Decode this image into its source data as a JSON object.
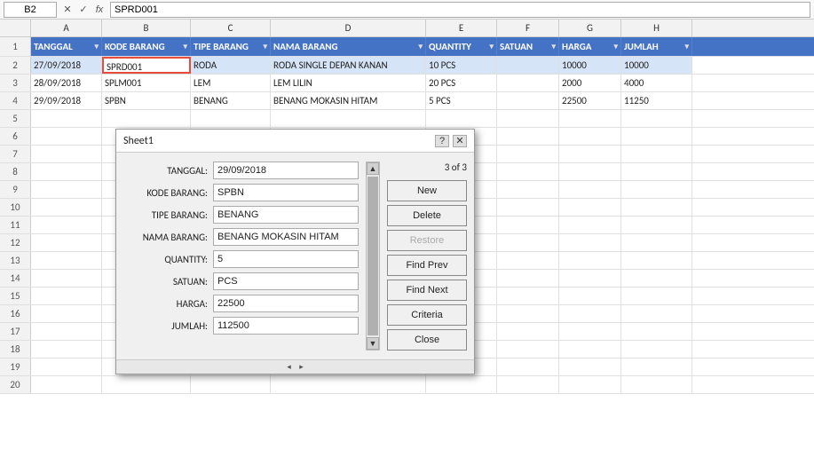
{
  "formulaBar": {
    "nameBox": "B2",
    "formulaValue": "SPRD001",
    "cancelIcon": "✕",
    "confirmIcon": "✓",
    "fxIcon": "fx"
  },
  "colHeaders": [
    "A",
    "B",
    "C",
    "D",
    "E",
    "F",
    "G",
    "H"
  ],
  "tableHeaders": [
    {
      "label": "TANGGAL",
      "col": "col-A"
    },
    {
      "label": "KODE BARANG",
      "col": "col-B"
    },
    {
      "label": "TIPE BARANG",
      "col": "col-C"
    },
    {
      "label": "NAMA BARANG",
      "col": "col-D"
    },
    {
      "label": "QUANTITY",
      "col": "col-E"
    },
    {
      "label": "SATUAN",
      "col": "col-F"
    },
    {
      "label": "HARGA",
      "col": "col-G"
    },
    {
      "label": "JUMLAH",
      "col": "col-H"
    }
  ],
  "rows": [
    {
      "rowNum": "2",
      "tanggal": "27/09/2018",
      "kodeBarang": "SPRD001",
      "tipeBarang": "RODA",
      "namaBarang": "RODA SINGLE DEPAN KANAN",
      "quantity": "10 PCS",
      "satuan": "",
      "harga": "10000",
      "jumlah": "10000"
    },
    {
      "rowNum": "3",
      "tanggal": "28/09/2018",
      "kodeBarang": "SPLM001",
      "tipeBarang": "LEM",
      "namaBarang": "LEM LILIN",
      "quantity": "20 PCS",
      "satuan": "",
      "harga": "2000",
      "jumlah": "4000"
    },
    {
      "rowNum": "4",
      "tanggal": "29/09/2018",
      "kodeBarang": "SPBN",
      "tipeBarang": "BENANG",
      "namaBarang": "BENANG MOKASIN HITAM",
      "quantity": "5 PCS",
      "satuan": "",
      "harga": "22500",
      "jumlah": "11250"
    }
  ],
  "emptyRows": [
    "5",
    "6",
    "7",
    "8",
    "9",
    "10",
    "11",
    "12",
    "13",
    "14",
    "15",
    "16",
    "17",
    "18",
    "19",
    "20"
  ],
  "dialog": {
    "title": "Sheet1",
    "helpIcon": "?",
    "closeIcon": "✕",
    "recordInfo": "3 of 3",
    "fields": [
      {
        "label": "TANGGAL:",
        "value": "29/09/2018",
        "name": "tanggal-field"
      },
      {
        "label": "KODE BARANG:",
        "value": "SPBN",
        "name": "kode-barang-field"
      },
      {
        "label": "TIPE BARANG:",
        "value": "BENANG",
        "name": "tipe-barang-field"
      },
      {
        "label": "NAMA BARANG:",
        "value": "BENANG MOKASIN HITAM",
        "name": "nama-barang-field"
      },
      {
        "label": "QUANTITY:",
        "value": "5",
        "name": "quantity-field"
      },
      {
        "label": "SATUAN:",
        "value": "PCS",
        "name": "satuan-field"
      },
      {
        "label": "HARGA:",
        "value": "22500",
        "name": "harga-field"
      },
      {
        "label": "JUMLAH:",
        "value": "112500",
        "name": "jumlah-field"
      }
    ],
    "buttons": [
      {
        "label": "New",
        "name": "new-button",
        "disabled": false
      },
      {
        "label": "Delete",
        "name": "delete-button",
        "disabled": false
      },
      {
        "label": "Restore",
        "name": "restore-button",
        "disabled": true
      },
      {
        "label": "Find Prev",
        "name": "find-prev-button",
        "disabled": false
      },
      {
        "label": "Find Next",
        "name": "find-next-button",
        "disabled": false
      },
      {
        "label": "Criteria",
        "name": "criteria-button",
        "disabled": false
      },
      {
        "label": "Close",
        "name": "close-button",
        "disabled": false
      }
    ]
  }
}
